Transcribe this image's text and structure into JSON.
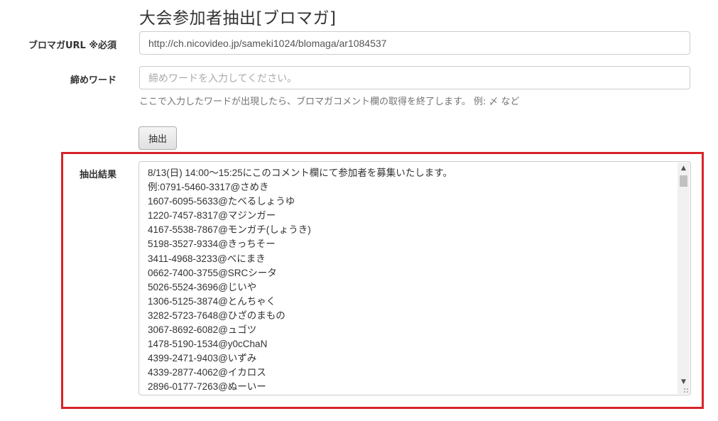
{
  "page": {
    "title": "大会参加者抽出[ブロマガ]"
  },
  "form": {
    "url_label": "ブロマガURL ※必須",
    "url_value": "http://ch.nicovideo.jp/sameki1024/blomaga/ar1084537",
    "keyword_label": "締めワード",
    "keyword_placeholder": "締めワードを入力してください。",
    "keyword_help": "ここで入力したワードが出現したら、ブロマガコメント欄の取得を終了します。 例: 〆 など",
    "submit_label": "抽出"
  },
  "result": {
    "label": "抽出結果",
    "lines": [
      "8/13(日) 14:00～15:25にこのコメント欄にて参加者を募集いたします。",
      "例:0791-5460-3317@さめき",
      "1607-6095-5633@たべるしょうゆ",
      "1220-7457-8317@マジンガー",
      "4167-5538-7867@モンガチ(しょうき)",
      "5198-3527-9334@きっちそー",
      "3411-4968-3233@べにまき",
      "0662-7400-3755@SRCシータ",
      "5026-5524-3696@じいや",
      "1306-5125-3874@とんちゃく",
      "3282-5723-7648@ひざのまもの",
      "3067-8692-6082@ュゴツ",
      "1478-5190-1534@y0cChaN",
      "4399-2471-9403@いずみ",
      "4339-2877-4062@イカロス",
      "2896-0177-7263@ぬーいー"
    ]
  },
  "colors": {
    "highlight_border": "#d8232a",
    "input_border": "#cccccc"
  },
  "icons": {
    "scroll_up": "▲",
    "scroll_down": "▼"
  }
}
